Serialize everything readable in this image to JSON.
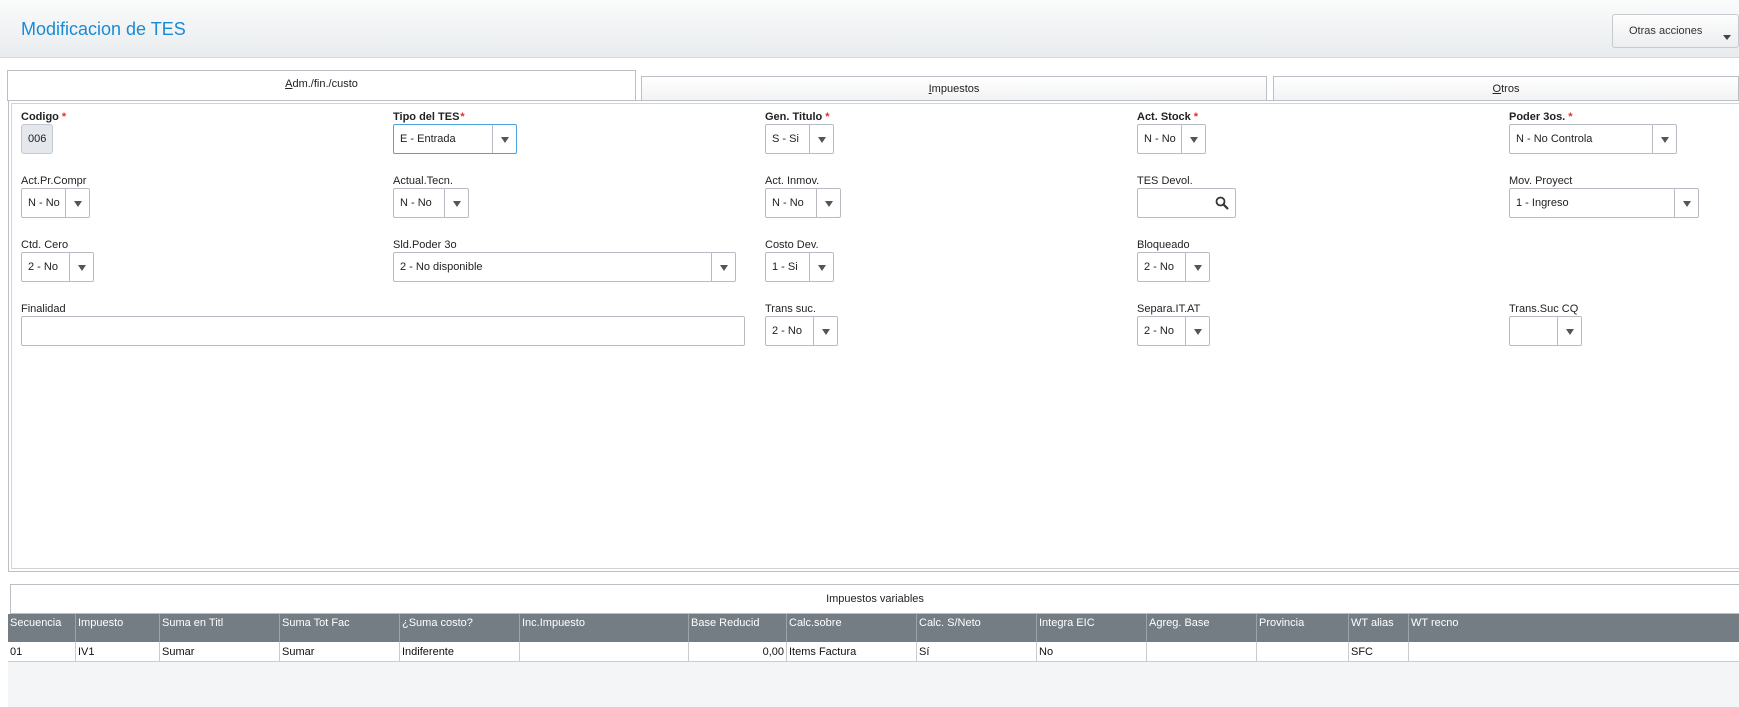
{
  "header": {
    "title": "Modificacion de TES",
    "actions_label": "Otras acciones"
  },
  "tabs": [
    {
      "prefix": "",
      "ul": "A",
      "rest": "dm./fin./custo"
    },
    {
      "prefix": "",
      "ul": "I",
      "rest": "mpuestos"
    },
    {
      "prefix": "",
      "ul": "O",
      "rest": "tros"
    }
  ],
  "form": {
    "codigo": {
      "label": "Codigo",
      "value": "006"
    },
    "tipo_tes": {
      "label": "Tipo del TES",
      "value": "E - Entrada"
    },
    "gen_titulo": {
      "label": "Gen. Titulo",
      "value": "S - Si"
    },
    "act_stock": {
      "label": "Act. Stock",
      "value": "N - No"
    },
    "poder_3os": {
      "label": "Poder 3os.",
      "value": "N - No Controla"
    },
    "act_pr_compr": {
      "label": "Act.Pr.Compr",
      "value": "N - No"
    },
    "actual_tecn": {
      "label": "Actual.Tecn.",
      "value": "N - No"
    },
    "act_inmov": {
      "label": "Act. Inmov.",
      "value": "N - No"
    },
    "tes_devol": {
      "label": "TES Devol.",
      "value": ""
    },
    "mov_proyect": {
      "label": "Mov. Proyect",
      "value": "1 - Ingreso"
    },
    "ctd_cero": {
      "label": "Ctd. Cero",
      "value": "2 - No"
    },
    "sld_poder_3o": {
      "label": "Sld.Poder 3o",
      "value": "2 - No disponible"
    },
    "costo_dev": {
      "label": "Costo Dev.",
      "value": "1 - Si"
    },
    "bloqueado": {
      "label": "Bloqueado",
      "value": "2 - No"
    },
    "finalidad": {
      "label": "Finalidad",
      "value": ""
    },
    "trans_suc": {
      "label": "Trans suc.",
      "value": "2 - No"
    },
    "separa_it_at": {
      "label": "Separa.IT.AT",
      "value": "2 - No"
    },
    "trans_suc_cq": {
      "label": "Trans.Suc CQ",
      "value": ""
    }
  },
  "grid": {
    "title": "Impuestos variables",
    "columns": [
      "Secuencia",
      "Impuesto",
      "Suma en Titl",
      "Suma Tot Fac",
      "¿Suma costo?",
      "Inc.Impuesto",
      "Base Reducid",
      "Calc.sobre",
      "Calc. S/Neto",
      "Integra EIC",
      "Agreg. Base",
      "Provincia",
      "WT alias",
      "WT recno"
    ],
    "rows": [
      [
        "01",
        "IV1",
        "Sumar",
        "Sumar",
        "Indiferente",
        "",
        "0,00",
        "Items Factura",
        "Sí",
        "No",
        "",
        "",
        "SFC",
        ""
      ]
    ]
  }
}
